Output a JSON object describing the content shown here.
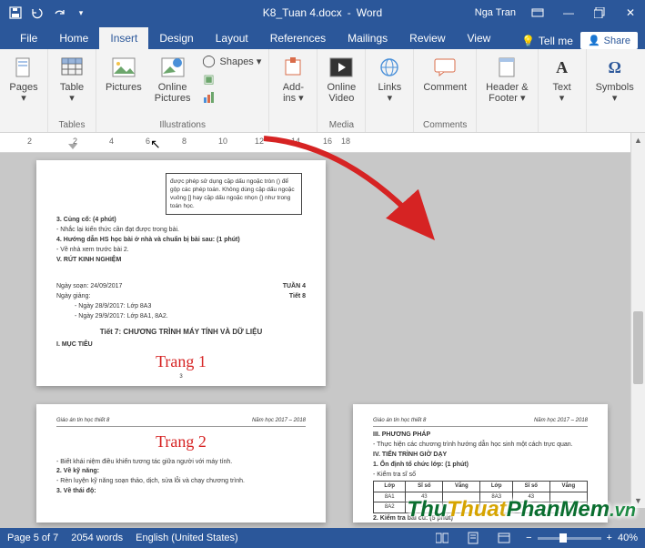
{
  "title": {
    "filename": "K8_Tuan 4.docx",
    "app": "Word",
    "user": "Nga Tran"
  },
  "qat": {
    "save": "💾",
    "undo": "↶",
    "redo": "↷"
  },
  "winctrl": {
    "ribbonopts": "▭",
    "min": "—",
    "restore": "❐",
    "close": "✕"
  },
  "tabs": {
    "file": "File",
    "home": "Home",
    "insert": "Insert",
    "design": "Design",
    "layout": "Layout",
    "references": "References",
    "mailings": "Mailings",
    "review": "Review",
    "view": "View",
    "tellme": "Tell me",
    "share": "Share"
  },
  "ribbon": {
    "pages": {
      "label": "Pages",
      "cap": "▾"
    },
    "tables": {
      "label": "Tables",
      "table": "Table",
      "cap": "▾"
    },
    "illustrations": {
      "label": "Illustrations",
      "pictures": "Pictures",
      "online": "Online\nPictures",
      "shapes": "Shapes ▾",
      "smartart": "⬢",
      "chart": "📊"
    },
    "addins": {
      "label": " ",
      "addins": "Add-\nins ▾"
    },
    "media": {
      "label": "Media",
      "video": "Online\nVideo"
    },
    "links": {
      "label": " ",
      "links": "Links",
      "cap": "▾"
    },
    "comments": {
      "label": "Comments",
      "comment": "Comment"
    },
    "headerfooter": {
      "label": " ",
      "hf": "Header &\nFooter ▾"
    },
    "text": {
      "label": " ",
      "text": "Text",
      "cap": "▾"
    },
    "symbols": {
      "label": " ",
      "symbols": "Symbols",
      "cap": "▾"
    }
  },
  "ruler": {
    "marks": [
      "2",
      "2",
      "4",
      "6",
      "8",
      "10",
      "12",
      "14",
      "16",
      "18"
    ]
  },
  "doc": {
    "page1": {
      "textbox": "được phép sử dụng cặp dấu ngoặc tròn () để gộp các phép toán. Không dùng cặp dấu ngoặc vuông [] hay cặp dấu ngoặc nhọn {} như trong toán học.",
      "l1": "3. Củng cố: (4 phút)",
      "l2": "- Nhắc lại kiến thức cần đạt được trong bài.",
      "l3": "4. Hướng dẫn HS học bài ở nhà và chuẩn bị bài sau: (1 phút)",
      "l4": "- Về nhà xem trước bài 2.",
      "l5": "V. RÚT KINH NGHIỆM",
      "ngaysoan_l": "Ngày soạn: 24/09/2017",
      "tuan": "TUẦN 4",
      "ngayging": "Ngày giảng:",
      "tiet": "Tiết 8",
      "g1": "- Ngày 28/9/2017: Lớp 8A3",
      "g2": "- Ngày 29/9/2017: Lớp 8A1, 8A2.",
      "title": "Tiết 7: CHƯƠNG TRÌNH MÁY TÍNH VÀ DỮ LIỆU",
      "muc": "I. MỤC TIÊU",
      "ann": "Trang 1",
      "pagenum": "3"
    },
    "page2": {
      "hdr_l": "Giáo án tin học thiết 8",
      "hdr_r": "Năm học 2017 – 2018",
      "ann": "Trang 2",
      "l1": "- Biết khái niệm điều khiển tương tác giữa người với máy tính.",
      "l2": "2. Về kỹ năng:",
      "l3": "- Rèn luyện kỹ năng soạn thảo, dịch, sửa lỗi và chạy chương trình.",
      "l4": "3. Về thái độ:"
    },
    "page3": {
      "hdr_l": "Giáo án tin học thiết 8",
      "hdr_r": "Năm học 2017 – 2018",
      "l1": "III. PHƯƠNG PHÁP",
      "l2": "- Thực hiện các chương trình hướng dẫn học sinh một cách trực quan.",
      "l3": "IV. TIẾN TRÌNH GIỜ DẠY",
      "l4": "1. Ổn định tổ chức lớp: (1 phút)",
      "l5": "- Kiểm tra sĩ số",
      "th": [
        "Lớp",
        "Sĩ số",
        "Vắng",
        "Lớp",
        "Sĩ số",
        "Vắng"
      ],
      "r1": [
        "8A1",
        "43",
        "",
        "8A3",
        "43",
        ""
      ],
      "r2": [
        "8A2",
        "43",
        "",
        "",
        "",
        ""
      ],
      "l6": "2. Kiểm tra bài cũ: (5 phút)"
    }
  },
  "status": {
    "page": "Page 5 of 7",
    "words": "2054 words",
    "lang": "English (United States)",
    "zoom_out": "−",
    "zoom_in": "+",
    "zoom": "40%"
  },
  "watermark": {
    "a": "Thu",
    "b": "Thuat",
    "c": "PhanMem",
    "d": ".vn"
  }
}
